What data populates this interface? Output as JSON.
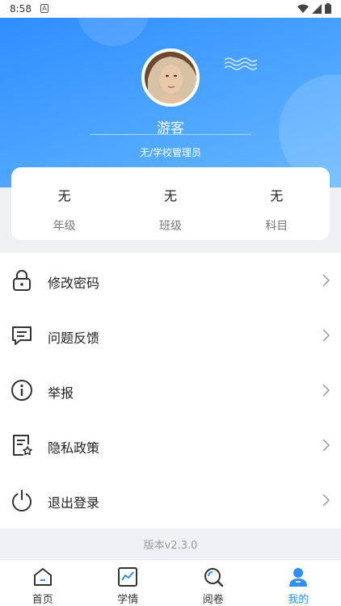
{
  "status_bar": {
    "time": "8:58",
    "notification_icon": "A"
  },
  "profile": {
    "name": "游客",
    "role": "无/学校管理员",
    "stats": [
      {
        "value": "无",
        "label": "年级"
      },
      {
        "value": "无",
        "label": "班级"
      },
      {
        "value": "无",
        "label": "科目"
      }
    ]
  },
  "menu": [
    {
      "label": "修改密码",
      "icon": "lock-icon"
    },
    {
      "label": "问题反馈",
      "icon": "chat-icon"
    },
    {
      "label": "举报",
      "icon": "info-icon"
    },
    {
      "label": "隐私政策",
      "icon": "policy-icon"
    },
    {
      "label": "退出登录",
      "icon": "power-icon"
    }
  ],
  "version": "版本v2.3.0",
  "tabs": [
    {
      "label": "首页",
      "icon": "home-icon"
    },
    {
      "label": "学情",
      "icon": "chart-icon"
    },
    {
      "label": "阅卷",
      "icon": "search-icon"
    },
    {
      "label": "我的",
      "icon": "user-icon",
      "active": true
    }
  ],
  "colors": {
    "accent": "#2f8dff",
    "hero_start": "#2f8dff",
    "hero_end": "#66b7ff"
  }
}
